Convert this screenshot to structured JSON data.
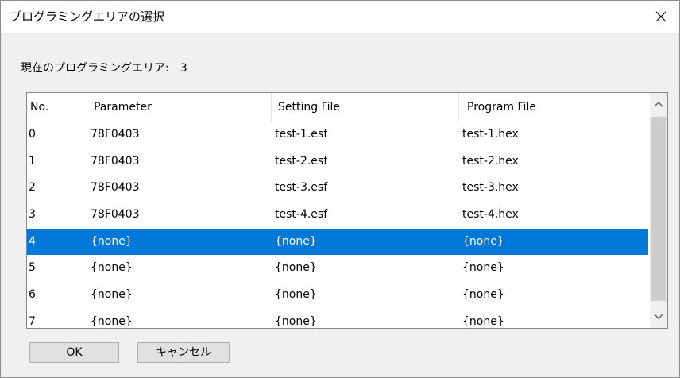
{
  "window": {
    "title": "プログラミングエリアの選択",
    "close_icon": "close-icon"
  },
  "current_area": {
    "label": "現在のプログラミングエリア:",
    "value": "3"
  },
  "list": {
    "columns": [
      "No.",
      "Parameter",
      "Setting File",
      "Program File"
    ],
    "rows": [
      {
        "no": "0",
        "parameter": "78F0403",
        "setting_file": "test-1.esf",
        "program_file": "test-1.hex",
        "selected": false
      },
      {
        "no": "1",
        "parameter": "78F0403",
        "setting_file": "test-2.esf",
        "program_file": "test-2.hex",
        "selected": false
      },
      {
        "no": "2",
        "parameter": "78F0403",
        "setting_file": "test-3.esf",
        "program_file": "test-3.hex",
        "selected": false
      },
      {
        "no": "3",
        "parameter": "78F0403",
        "setting_file": "test-4.esf",
        "program_file": "test-4.hex",
        "selected": false
      },
      {
        "no": "4",
        "parameter": "{none}",
        "setting_file": "{none}",
        "program_file": "{none}",
        "selected": true
      },
      {
        "no": "5",
        "parameter": "{none}",
        "setting_file": "{none}",
        "program_file": "{none}",
        "selected": false
      },
      {
        "no": "6",
        "parameter": "{none}",
        "setting_file": "{none}",
        "program_file": "{none}",
        "selected": false
      },
      {
        "no": "7",
        "parameter": "{none}",
        "setting_file": "{none}",
        "program_file": "{none}",
        "selected": false
      }
    ],
    "selection_color": "#0078d7"
  },
  "buttons": {
    "ok": "OK",
    "cancel": "キャンセル"
  }
}
